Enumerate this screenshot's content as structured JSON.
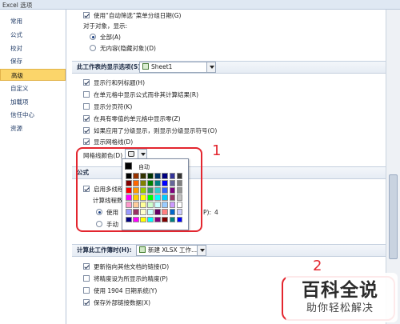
{
  "window": {
    "title": "Excel 选项"
  },
  "sidebar": {
    "items": [
      {
        "label": "常用"
      },
      {
        "label": "公式"
      },
      {
        "label": "校对"
      },
      {
        "label": "保存"
      },
      {
        "label": "高级",
        "active": true
      },
      {
        "label": "自定义"
      },
      {
        "label": "加载项"
      },
      {
        "label": "信任中心"
      },
      {
        "label": "资源"
      }
    ]
  },
  "top": {
    "cut_row": "使用“自动筛选”菜单分组日期(G)",
    "objects_label": "对于对象，显示:",
    "radio_all": "全部(A)",
    "radio_none": "无内容(隐藏对象)(D)"
  },
  "worksheet_section": {
    "title": "此工作表的显示选项(S):",
    "sheet_value": "Sheet1",
    "options": [
      {
        "label": "显示行和列标题(H)",
        "checked": true
      },
      {
        "label": "在单元格中显示公式而非其计算结果(R)",
        "checked": false
      },
      {
        "label": "显示分页符(K)",
        "checked": false
      },
      {
        "label": "在具有零值的单元格中显示零(Z)",
        "checked": true
      },
      {
        "label": "如果应用了分级显示，则显示分级显示符号(O)",
        "checked": true
      },
      {
        "label": "显示网格线(D)",
        "checked": true
      }
    ],
    "gridline_label": "网格线颜色(D)"
  },
  "palette": {
    "auto_label": "自动",
    "colors": [
      "#000000",
      "#993300",
      "#333300",
      "#003300",
      "#003366",
      "#000080",
      "#333399",
      "#333333",
      "#800000",
      "#ff6600",
      "#808000",
      "#008000",
      "#008080",
      "#0000ff",
      "#666699",
      "#808080",
      "#ff0000",
      "#ff9900",
      "#99cc00",
      "#339966",
      "#33cccc",
      "#3366ff",
      "#800080",
      "#969696",
      "#ff00ff",
      "#ffcc00",
      "#ffff00",
      "#00ff00",
      "#00ffff",
      "#00ccff",
      "#993366",
      "#c0c0c0",
      "#ff99cc",
      "#ffcc99",
      "#ffff99",
      "#ccffcc",
      "#ccffff",
      "#99ccff",
      "#cc99ff",
      "#ffffff",
      "#9999ff",
      "#993366",
      "#ffffcc",
      "#ccffff",
      "#660066",
      "#ff8080",
      "#0066cc",
      "#ccccff",
      "#000080",
      "#ff00ff",
      "#ffff00",
      "#00ffff",
      "#800080",
      "#800000",
      "#008080",
      "#0000ff"
    ]
  },
  "formula_section": {
    "title": "公式",
    "multithread": "启用多线程计",
    "threads_label": "计算线程数",
    "use_label": "使用",
    "manual_label": "手动",
    "cut_p": "P):",
    "cut_4": "4"
  },
  "workbook_section": {
    "title": "计算此工作簿时(H):",
    "book_value": "新建 XLSX 工作...",
    "options": [
      {
        "label": "更新指向其他文档的链接(D)",
        "checked": true
      },
      {
        "label": "将精度设为所显示的精度(P)",
        "checked": false
      },
      {
        "label": "使用 1904 日期系统(Y)",
        "checked": false
      },
      {
        "label": "保存外部链接数据(X)",
        "checked": true
      }
    ]
  },
  "annotations": {
    "one": "1",
    "two": "2"
  },
  "watermark": {
    "line1": "百科全说",
    "line2": "助你轻松解决"
  }
}
